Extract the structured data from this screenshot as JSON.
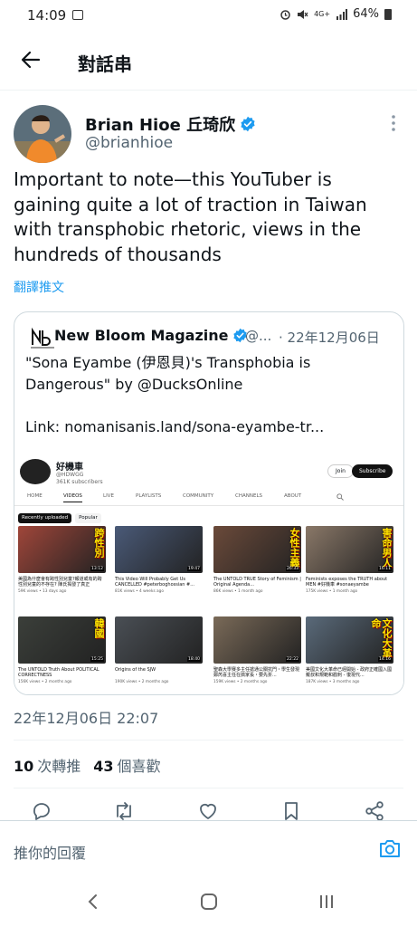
{
  "status_bar": {
    "time": "14:09",
    "network": "4G+",
    "battery": "64%"
  },
  "header": {
    "title": "對話串"
  },
  "tweet": {
    "author_name": "Brian Hioe 丘琦欣",
    "author_handle": "@brianhioe",
    "text": "Important to note—this YouTuber is gaining quite a lot of traction in Taiwan with transphobic rhetoric, views in the hundreds of thousands",
    "translate_label": "翻譯推文",
    "timestamp": "22年12月06日 22:07",
    "retweets_count": "10",
    "retweets_label": "次轉推",
    "likes_count": "43",
    "likes_label": "個喜歡"
  },
  "quote": {
    "author_name": "New Bloom Magazine",
    "author_handle": "@...",
    "date": "· 22年12月06日",
    "text": "\"Sona Eyambe (伊恩貝)'s Transphobia is Dangerous\" by @DucksOnline",
    "link": "Link: nomanisanis.land/sona-eyambe-tr..."
  },
  "youtube": {
    "channel_name": "好機車",
    "channel_handle": "@HDWGG",
    "channel_subs": "361K subscribers",
    "join_label": "Join",
    "subscribe_label": "Subscribe",
    "tabs": [
      "HOME",
      "VIDEOS",
      "LIVE",
      "PLAYLISTS",
      "COMMUNITY",
      "CHANNELS",
      "ABOUT"
    ],
    "active_tab": "VIDEOS",
    "chips": [
      "Recently uploaded",
      "Popular"
    ],
    "videos": [
      {
        "caption": "跨性別",
        "duration": "13:12",
        "title": "美國為什麼會有跨性別兒童?報道或有的跨性別兒童的不存在? 陳氏揭發了真正",
        "meta": "59K views • 13 days ago",
        "bg": "#a0463a"
      },
      {
        "caption": "",
        "duration": "19:47",
        "title": "This Video Will Probably Get Us CANCELLED #peterboghossian #...",
        "meta": "81K views • 4 weeks ago",
        "bg": "#4a5a78"
      },
      {
        "caption": "女性主義",
        "duration": "26:33",
        "title": "The UNTOLD TRUE Story of Feminism | Original Agenda...",
        "meta": "86K views • 1 month ago",
        "bg": "#6b4a3a"
      },
      {
        "caption": "害命男人",
        "duration": "16:11",
        "title": "Feminists exposes the TRUTH about MEN #好機車 #sonaeyambe",
        "meta": "175K views • 1 month ago",
        "bg": "#8a7868"
      },
      {
        "caption": "韓國",
        "duration": "15:25",
        "title": "The UNTOLD Truth About POLITICAL CORRECTNESS",
        "meta": "156K views • 2 months ago",
        "bg": "#3b3f3a"
      },
      {
        "caption": "",
        "duration": "18:40",
        "title": "Origins of the SJW",
        "meta": "190K views • 2 months ago",
        "bg": "#4a4f55"
      },
      {
        "caption": "",
        "duration": "22:22",
        "title": "聖森大學赛多主任搶通公關抗門・學生發現鄭芮喜主任在搞家長・要先折...",
        "meta": "159K views • 2 months ago",
        "bg": "#7a6a58"
      },
      {
        "caption": "文化大革命",
        "duration": "14:16",
        "title": "美國文化大革命已經開始 - 政府正確國入國戴叔和規範和戳刺 - 復現代...",
        "meta": "187K views • 3 months ago",
        "bg": "#5a6a7a"
      }
    ]
  },
  "reply": {
    "placeholder": "推你的回覆"
  },
  "colors": {
    "accent": "#1d9bf0",
    "secondary_text": "#536471"
  }
}
